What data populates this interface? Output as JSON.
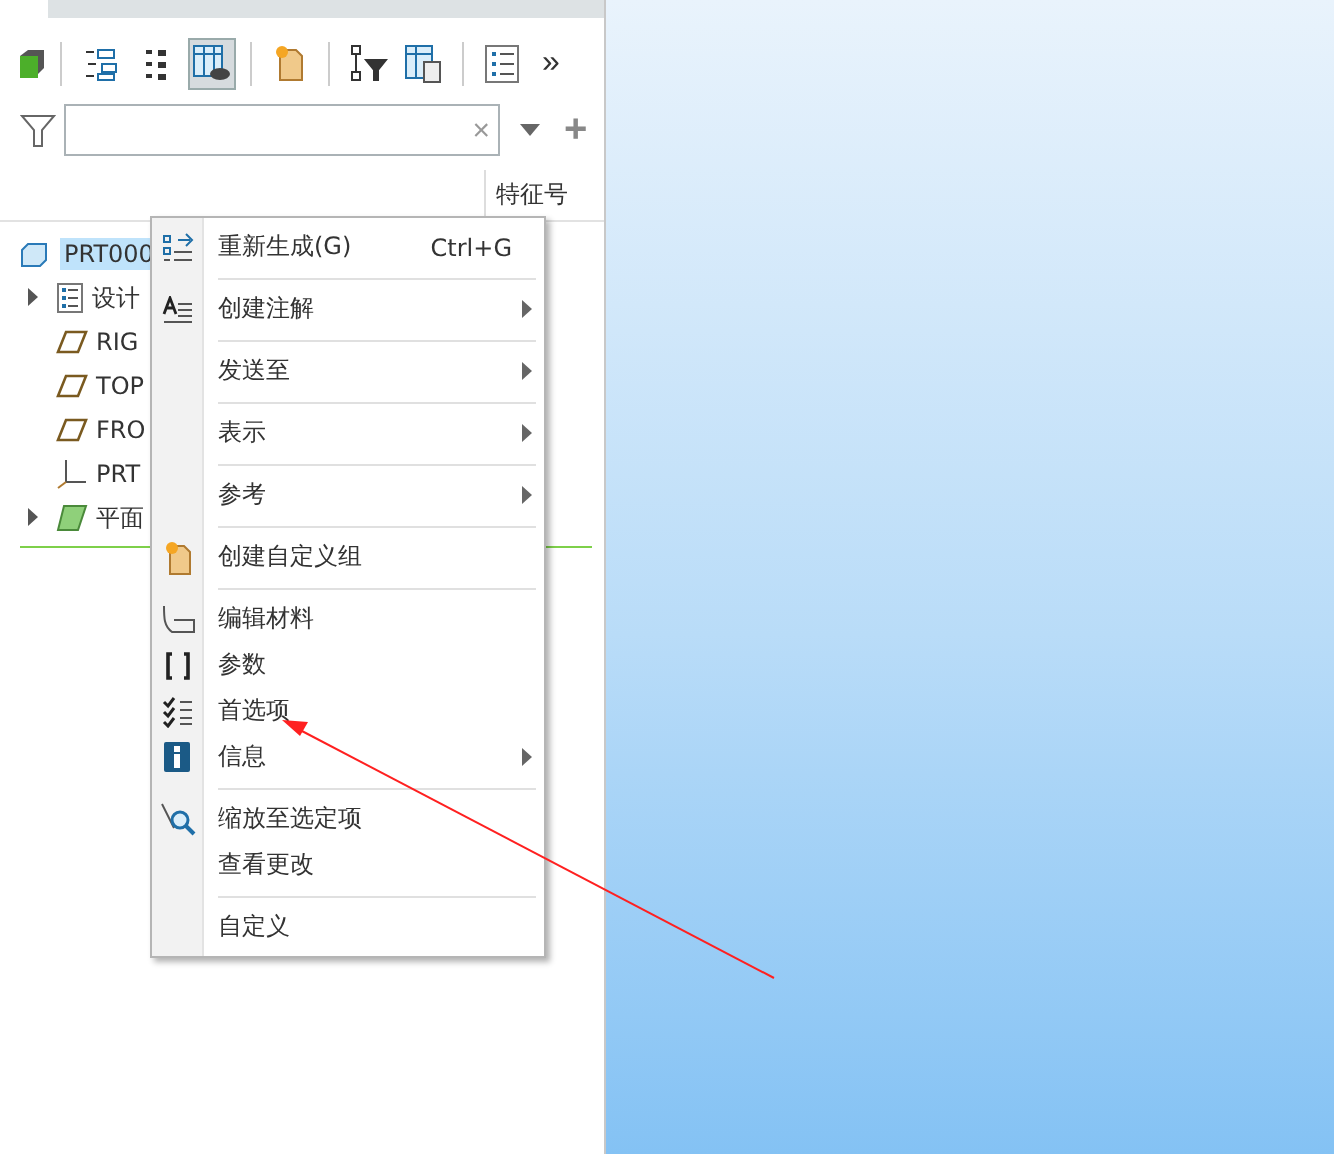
{
  "toolbar": {
    "buttons": [
      {
        "selected": false
      },
      {
        "selected": false
      },
      {
        "selected": true
      },
      {
        "selected": false
      },
      {
        "selected": false
      },
      {
        "selected": false
      },
      {
        "selected": false
      }
    ],
    "overflow": "»"
  },
  "filter": {
    "clear": "×",
    "add": "+"
  },
  "tree_header": {
    "column_2": "特征号"
  },
  "tree": {
    "name": "PRT000",
    "selected": true,
    "children": [
      {
        "name": "设计",
        "kind": "notes",
        "expandable": true
      },
      {
        "name": "RIG",
        "kind": "plane",
        "expandable": false
      },
      {
        "name": "TOP",
        "kind": "plane",
        "expandable": false
      },
      {
        "name": "FRO",
        "kind": "plane",
        "expandable": false
      },
      {
        "name": "PRT",
        "kind": "csys",
        "expandable": false
      },
      {
        "name": "平面",
        "kind": "surface",
        "expandable": true
      }
    ]
  },
  "context_menu": {
    "groups": [
      [
        {
          "label": "重新生成(G)",
          "shortcut": "Ctrl+G",
          "submenu": false
        }
      ],
      [
        {
          "label": "创建注解",
          "submenu": true
        }
      ],
      [
        {
          "label": "发送至",
          "submenu": true
        }
      ],
      [
        {
          "label": "表示",
          "submenu": true
        }
      ],
      [
        {
          "label": "参考",
          "submenu": true
        }
      ],
      [
        {
          "label": "创建自定义组",
          "submenu": false
        }
      ],
      [
        {
          "label": "编辑材料",
          "submenu": false
        },
        {
          "label": "参数",
          "submenu": false
        },
        {
          "label": "首选项",
          "submenu": false
        },
        {
          "label": "信息",
          "submenu": true
        }
      ],
      [
        {
          "label": "缩放至选定项",
          "submenu": false
        },
        {
          "label": "查看更改",
          "submenu": false
        }
      ],
      [
        {
          "label": "自定义",
          "submenu": false
        }
      ]
    ]
  }
}
